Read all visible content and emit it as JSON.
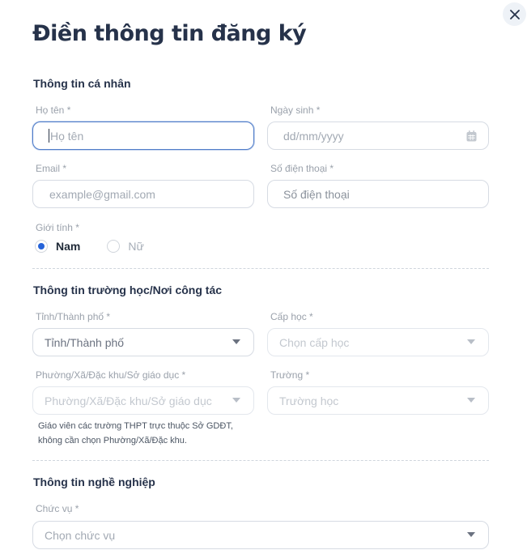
{
  "title": "Điền thông tin đăng ký",
  "icons": {
    "close": "close-icon",
    "calendar": "calendar-icon",
    "chevron": "chevron-down-icon"
  },
  "personal": {
    "section_title": "Thông tin cá nhân",
    "name": {
      "label": "Họ tên *",
      "placeholder": "Họ tên"
    },
    "dob": {
      "label": "Ngày sinh *",
      "placeholder": "dd/mm/yyyy"
    },
    "email": {
      "label": "Email *",
      "placeholder": "example@gmail.com"
    },
    "phone": {
      "label": "Số điện thoại *",
      "placeholder": "Số điện thoại"
    },
    "gender": {
      "label": "Giới tính *",
      "options": [
        {
          "label": "Nam",
          "selected": true
        },
        {
          "label": "Nữ",
          "selected": false
        }
      ]
    }
  },
  "school": {
    "section_title": "Thông tin trường học/Nơi công tác",
    "province": {
      "label": "Tỉnh/Thành phố *",
      "value": "Tỉnh/Thành phố"
    },
    "level": {
      "label": "Cấp học *",
      "placeholder": "Chọn cấp học"
    },
    "ward": {
      "label": "Phường/Xã/Đặc khu/Sở giáo dục *",
      "placeholder": "Phường/Xã/Đặc khu/Sở giáo dục"
    },
    "school_field": {
      "label": "Trường *",
      "placeholder": "Trường học"
    },
    "hint_line1": "Giáo viên các trường THPT trực thuộc Sở GDĐT,",
    "hint_line2": "không cần chọn Phường/Xã/Đặc khu."
  },
  "career": {
    "section_title": "Thông tin nghề nghiệp",
    "position": {
      "label": "Chức vụ *",
      "placeholder": "Chọn chức vụ"
    }
  },
  "colors": {
    "accent": "#2563d9",
    "title": "#26324a",
    "focus_border": "#4f7cc9"
  }
}
